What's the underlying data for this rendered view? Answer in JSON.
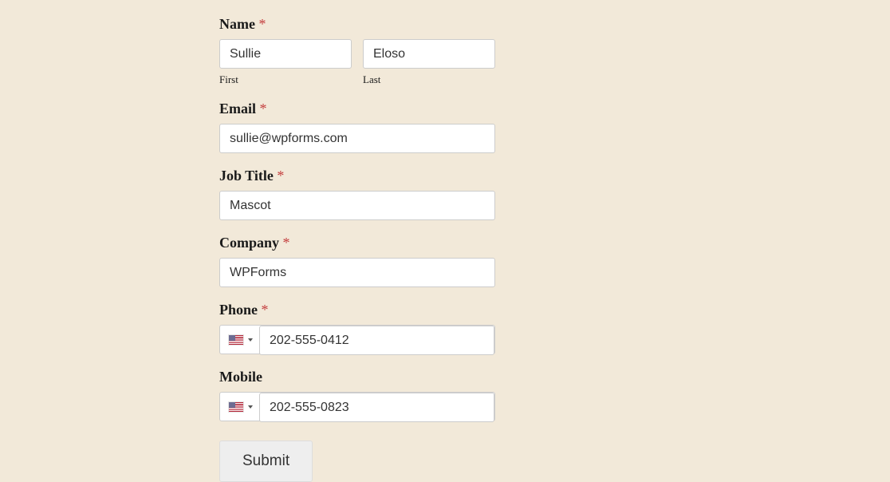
{
  "form": {
    "name": {
      "label": "Name",
      "first": {
        "sublabel": "First",
        "value": "Sullie"
      },
      "last": {
        "sublabel": "Last",
        "value": "Eloso"
      }
    },
    "email": {
      "label": "Email",
      "value": "sullie@wpforms.com"
    },
    "job_title": {
      "label": "Job Title",
      "value": "Mascot"
    },
    "company": {
      "label": "Company",
      "value": "WPForms"
    },
    "phone": {
      "label": "Phone",
      "value": "202-555-0412",
      "country": "US"
    },
    "mobile": {
      "label": "Mobile",
      "value": "202-555-0823",
      "country": "US"
    },
    "submit": {
      "label": "Submit"
    },
    "required_marker": "*"
  }
}
